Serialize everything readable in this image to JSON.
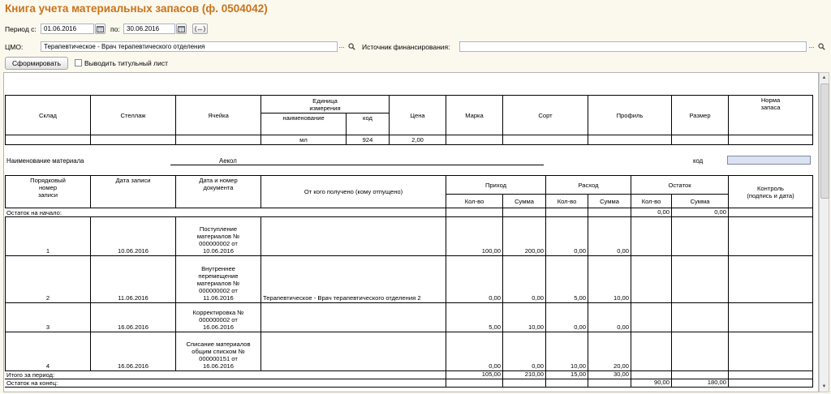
{
  "window": {
    "title": "Книга учета материальных запасов (ф. 0504042)"
  },
  "period": {
    "from_label": "Период с:",
    "from_value": "01.06.2016",
    "to_label": "по:",
    "to_value": "30.06.2016",
    "calendar_icon": "calendar-icon",
    "period_choice_label": "(↔)"
  },
  "cmo": {
    "label": "ЦМО:",
    "value": "Терапевтическое - Врач терапевтического отделения",
    "ellipsis_label": "...",
    "search_icon": "magnifier-icon"
  },
  "funding": {
    "label": "Источник финансирования:",
    "value": "",
    "ellipsis_label": "..."
  },
  "toolbar": {
    "generate_label": "Сформировать",
    "title_sheet_label": "Выводить титульный лист",
    "title_sheet_checked": false
  },
  "report": {
    "header": {
      "sklad": "Склад",
      "stellazh": "Стеллаж",
      "yacheika": "Ячейка",
      "unit_l1": "Единица",
      "unit_l2": "измерения",
      "unit_name": "наименование",
      "unit_code": "код",
      "price": "Цена",
      "marka": "Марка",
      "sort": "Сорт",
      "profil": "Профиль",
      "razmer": "Размер",
      "norma_l1": "Норма",
      "norma_l2": "запаса"
    },
    "values": {
      "sklad": "",
      "stellazh": "",
      "yacheika": "",
      "unit_name": "мл",
      "unit_code": "924",
      "price": "2,00",
      "marka": "",
      "sort": "",
      "profil": "",
      "razmer": "",
      "norma": ""
    },
    "material": {
      "label": "Наименование материала",
      "name": "Аекол",
      "code_label": "код",
      "code_value": ""
    },
    "journal_header": {
      "num_l1": "Порядковый",
      "num_l2": "номер",
      "num_l3": "записи",
      "date": "Дата записи",
      "doc_l1": "Дата и номер",
      "doc_l2": "документа",
      "from": "От кого получено (кому отпущено)",
      "income": "Приход",
      "expense": "Расход",
      "balance": "Остаток",
      "control_l1": "Контроль",
      "control_l2": "(подпись и дата)",
      "qty": "Кол-во",
      "sum": "Сумма"
    },
    "opening": {
      "label": "Остаток на начало:",
      "qty": "0,00",
      "sum": "0,00"
    },
    "rows": [
      {
        "num": "1",
        "date": "10.06.2016",
        "doc": [
          "Поступление",
          "материалов №",
          "000000002 от",
          "10.06.2016"
        ],
        "from": "",
        "in_qty": "100,00",
        "in_sum": "200,00",
        "out_qty": "0,00",
        "out_sum": "0,00",
        "bal_qty": "",
        "bal_sum": "",
        "control": ""
      },
      {
        "num": "2",
        "date": "11.06.2016",
        "doc": [
          "Внутреннее",
          "перемещение",
          "материалов №",
          "000000002 от",
          "11.06.2016"
        ],
        "from": "Терапевтическое - Врач терапевтического отделения 2",
        "in_qty": "0,00",
        "in_sum": "0,00",
        "out_qty": "5,00",
        "out_sum": "10,00",
        "bal_qty": "",
        "bal_sum": "",
        "control": ""
      },
      {
        "num": "3",
        "date": "16.06.2016",
        "doc": [
          "Корректировка №",
          "000000002 от",
          "16.06.2016"
        ],
        "from": "",
        "in_qty": "5,00",
        "in_sum": "10,00",
        "out_qty": "0,00",
        "out_sum": "0,00",
        "bal_qty": "",
        "bal_sum": "",
        "control": ""
      },
      {
        "num": "4",
        "date": "16.06.2016",
        "doc": [
          "Списание материалов",
          "общим списком №",
          "000000151 от",
          "16.06.2016"
        ],
        "from": "",
        "in_qty": "0,00",
        "in_sum": "0,00",
        "out_qty": "10,00",
        "out_sum": "20,00",
        "bal_qty": "",
        "bal_sum": "",
        "control": ""
      }
    ],
    "totals": {
      "label": "Итого за период:",
      "in_qty": "105,00",
      "in_sum": "210,00",
      "out_qty": "15,00",
      "out_sum": "30,00"
    },
    "closing": {
      "label": "Остаток на конец:",
      "qty": "90,00",
      "sum": "180,00"
    }
  },
  "colors": {
    "title": "#c8741a",
    "background": "#fbf8ee",
    "code_field": "#dde2f3"
  }
}
